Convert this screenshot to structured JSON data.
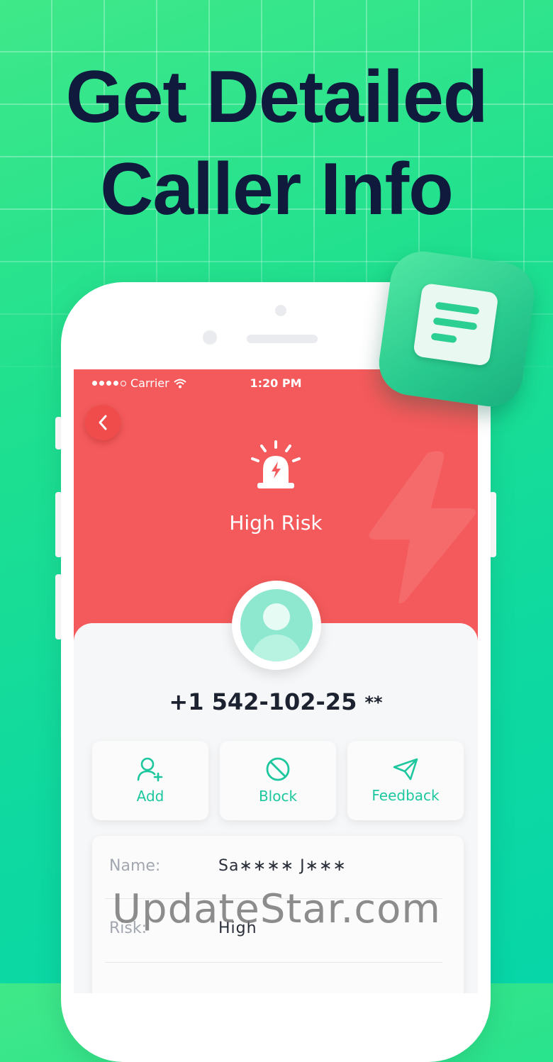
{
  "headline": {
    "line1": "Get Detailed",
    "line2": "Caller Info"
  },
  "status_bar": {
    "carrier": "Carrier",
    "time": "1:20 PM"
  },
  "risk": {
    "label": "High Risk",
    "color": "#f45a5b"
  },
  "caller": {
    "number": "+1 542-102-25",
    "number_masked_suffix": "**"
  },
  "actions": [
    {
      "label": "Add",
      "icon": "add-user-icon"
    },
    {
      "label": "Block",
      "icon": "block-icon"
    },
    {
      "label": "Feedback",
      "icon": "send-icon"
    }
  ],
  "info": [
    {
      "key": "Name:",
      "value": "Sa∗∗∗∗  J∗∗∗"
    },
    {
      "key": "Risk:",
      "value": "High"
    }
  ],
  "accent_color": "#1dc79e",
  "watermark": "UpdateStar.com"
}
